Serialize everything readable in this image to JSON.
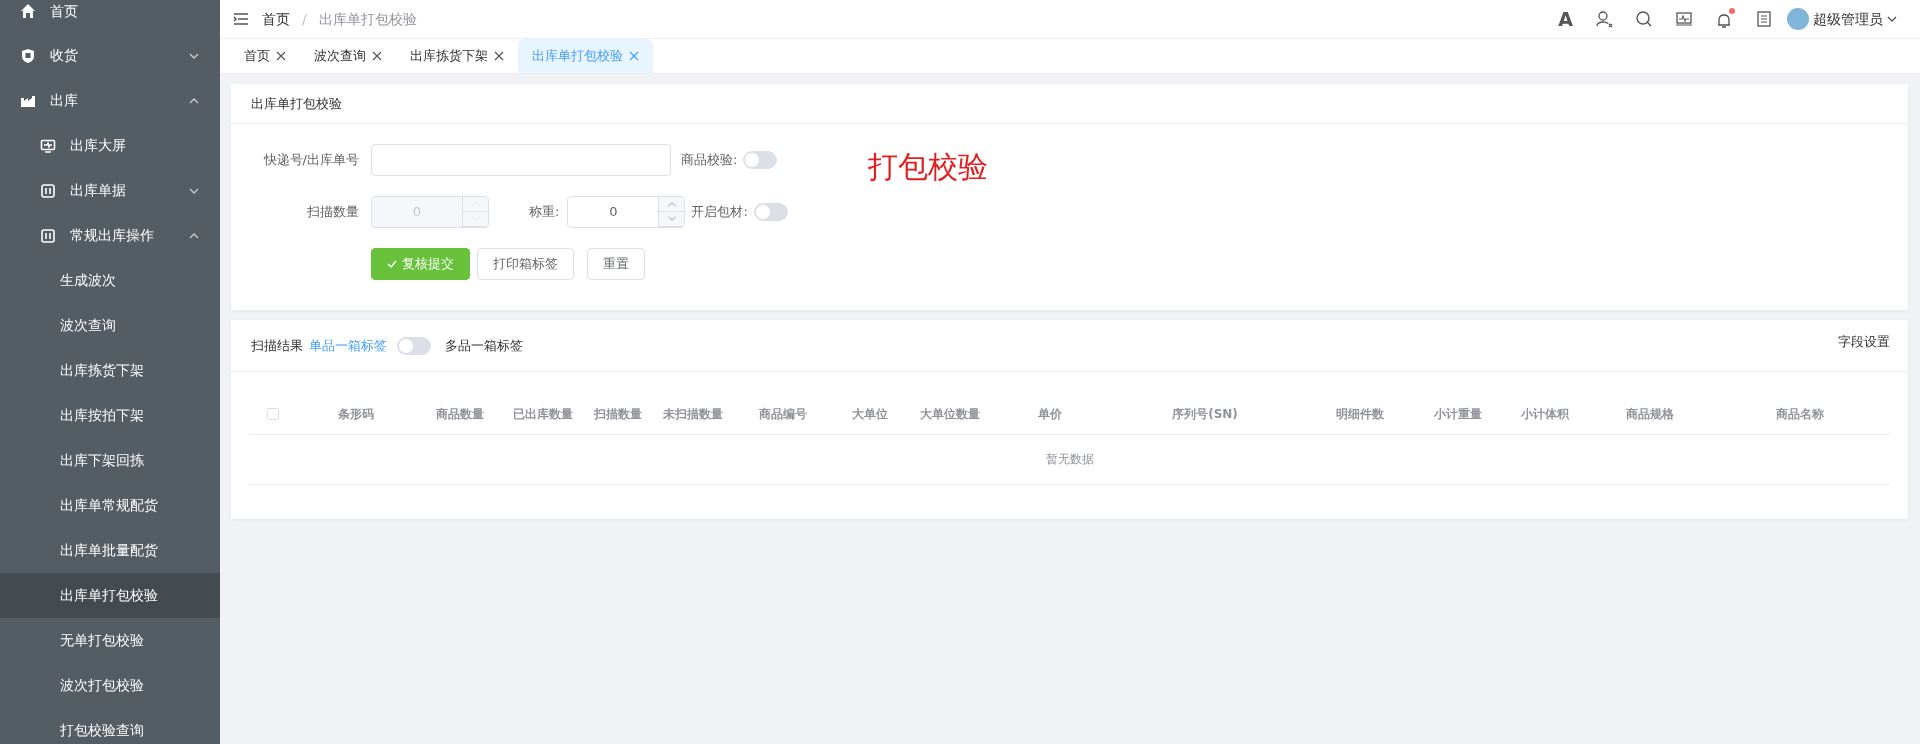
{
  "sidebar": {
    "items": [
      {
        "label": "首页"
      },
      {
        "label": "收货",
        "expanded": false
      },
      {
        "label": "出库",
        "expanded": true,
        "children": [
          {
            "label": "出库大屏"
          },
          {
            "label": "出库单据",
            "expanded": false
          },
          {
            "label": "常规出库操作",
            "expanded": true,
            "children": [
              {
                "label": "生成波次",
                "selected": false
              },
              {
                "label": "波次查询",
                "selected": false
              },
              {
                "label": "出库拣货下架",
                "selected": false
              },
              {
                "label": "出库按拍下架",
                "selected": false
              },
              {
                "label": "出库下架回拣",
                "selected": false
              },
              {
                "label": "出库单常规配货",
                "selected": false
              },
              {
                "label": "出库单批量配货",
                "selected": false
              },
              {
                "label": "出库单打包校验",
                "selected": true
              },
              {
                "label": "无单打包校验",
                "selected": false
              },
              {
                "label": "波次打包校验",
                "selected": false
              },
              {
                "label": "打包校验查询",
                "selected": false
              }
            ]
          }
        ]
      }
    ]
  },
  "header": {
    "breadcrumb": [
      "首页",
      "出库单打包校验"
    ],
    "breadcrumb_separator": "/",
    "font_button": "A",
    "has_notification": true,
    "user": "超级管理员"
  },
  "tabs": [
    {
      "label": "首页",
      "selected": false
    },
    {
      "label": "波次查询",
      "selected": false
    },
    {
      "label": "出库拣货下架",
      "selected": false
    },
    {
      "label": "出库单打包校验",
      "selected": true
    }
  ],
  "form_card": {
    "title": "出库单打包校验",
    "annotation": "打包校验",
    "tracking": {
      "label": "快递号/出库单号"
    },
    "goods_check": {
      "label": "商品校验:",
      "on": false
    },
    "scan_qty": {
      "label": "扫描数量",
      "value": "0",
      "disabled": true
    },
    "weight": {
      "label": "称重:",
      "value": "0",
      "disabled": false
    },
    "packaging": {
      "label": "开启包材:",
      "on": false
    },
    "buttons": [
      {
        "label": "复核提交",
        "kind": "primary"
      },
      {
        "label": "打印箱标签",
        "kind": "default"
      },
      {
        "label": "重置",
        "kind": "default"
      }
    ]
  },
  "results_card": {
    "title": "扫描结果",
    "left_label": "单品一箱标签",
    "right_label": "多品一箱标签",
    "on": false,
    "settings": "字段设置",
    "table": {
      "select_all": false,
      "columns": [
        "条形码",
        "商品数量",
        "已出库数量",
        "扫描数量",
        "未扫描数量",
        "商品编号",
        "大单位",
        "大单位数量",
        "单价",
        "序列号(SN)",
        "明细件数",
        "小计重量",
        "小计体积",
        "商品规格",
        "商品名称"
      ],
      "empty_text": "暂无数据"
    }
  }
}
